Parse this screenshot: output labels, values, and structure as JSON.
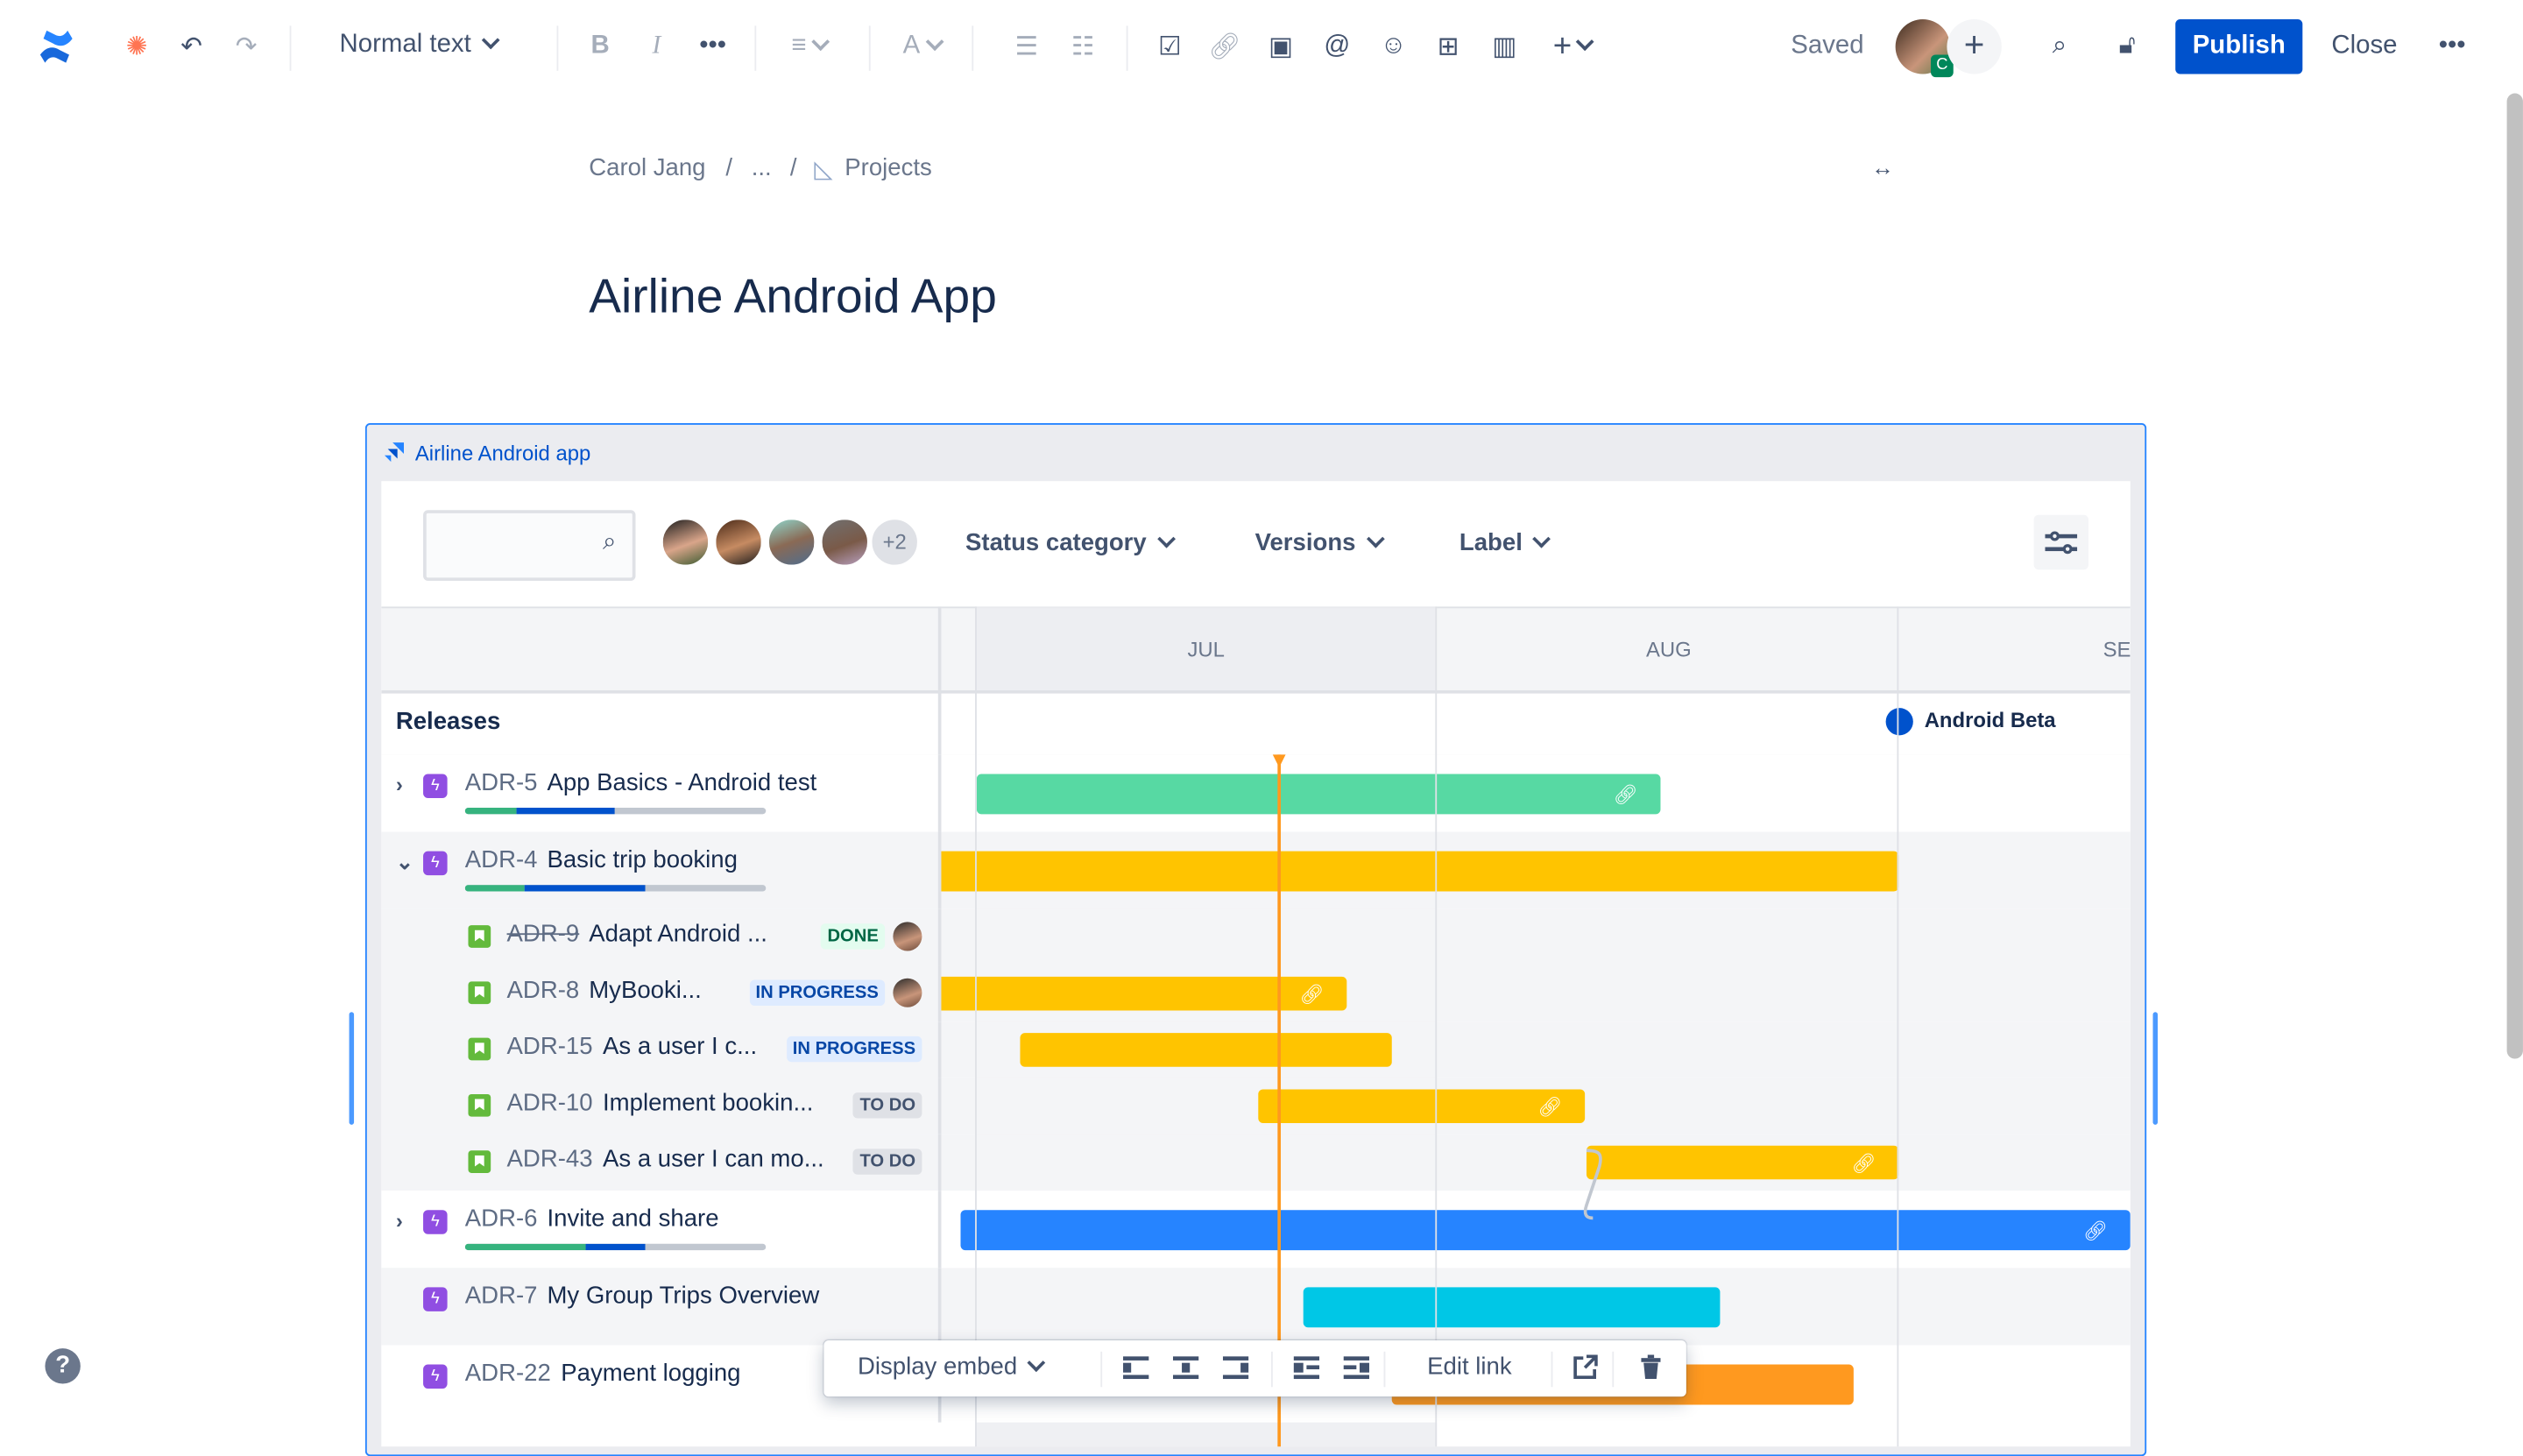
{
  "toolbar": {
    "text_style": "Normal text",
    "saved": "Saved",
    "publish": "Publish",
    "close": "Close",
    "collaborator_initial": "C",
    "colors": {
      "brand": "#0052CC",
      "collab_badge": "#00875A"
    }
  },
  "breadcrumb": {
    "items": [
      "Carol Jang",
      "...",
      "Projects"
    ],
    "separator": "/"
  },
  "page": {
    "title": "Airline Android App"
  },
  "embed": {
    "title": "Airline Android app",
    "search_placeholder": "",
    "avatar_overflow": "+2",
    "filters": [
      "Status category",
      "Versions",
      "Label"
    ],
    "months": [
      "JUL",
      "AUG",
      "SEI"
    ],
    "releases_label": "Releases",
    "release_marker": "Android Beta",
    "rows": [
      {
        "key": "ADR-5",
        "summary": "App Basics - Android test",
        "type": "epic",
        "expander": "collapsed",
        "progress": {
          "done": 0.17,
          "in_progress": 0.33
        },
        "bar_color": "#57D9A3",
        "linked": true
      },
      {
        "key": "ADR-4",
        "summary": "Basic trip booking",
        "type": "epic",
        "expander": "expanded",
        "progress": {
          "done": 0.2,
          "in_progress": 0.4
        },
        "bar_color": "#FFC400",
        "linked": false
      },
      {
        "key": "ADR-9",
        "summary": "Adapt Android ...",
        "type": "story",
        "status": "DONE",
        "done": true,
        "assignee": true
      },
      {
        "key": "ADR-8",
        "summary": "MyBooki...",
        "type": "story",
        "status": "IN PROGRESS",
        "assignee": true,
        "bar_color": "#FFC400",
        "linked": true
      },
      {
        "key": "ADR-15",
        "summary": "As a user I c...",
        "type": "story",
        "status": "IN PROGRESS",
        "bar_color": "#FFC400",
        "linked": false
      },
      {
        "key": "ADR-10",
        "summary": "Implement bookin...",
        "type": "story",
        "status": "TO DO",
        "bar_color": "#FFC400",
        "linked": true
      },
      {
        "key": "ADR-43",
        "summary": "As a user I can mo...",
        "type": "story",
        "status": "TO DO",
        "bar_color": "#FFC400",
        "linked": true
      },
      {
        "key": "ADR-6",
        "summary": "Invite and share",
        "type": "epic",
        "expander": "collapsed",
        "progress": {
          "done": 0.4,
          "in_progress": 0.2
        },
        "bar_color": "#2684FF",
        "linked": true
      },
      {
        "key": "ADR-7",
        "summary": "My Group Trips Overview",
        "type": "epic",
        "bar_color": "#00C7E6",
        "linked": false
      },
      {
        "key": "ADR-22",
        "summary": "Payment logging",
        "type": "epic",
        "bar_color": "#FF991F",
        "linked": false
      }
    ]
  },
  "floating_toolbar": {
    "display_embed": "Display embed",
    "edit_link": "Edit link"
  },
  "help": "?"
}
